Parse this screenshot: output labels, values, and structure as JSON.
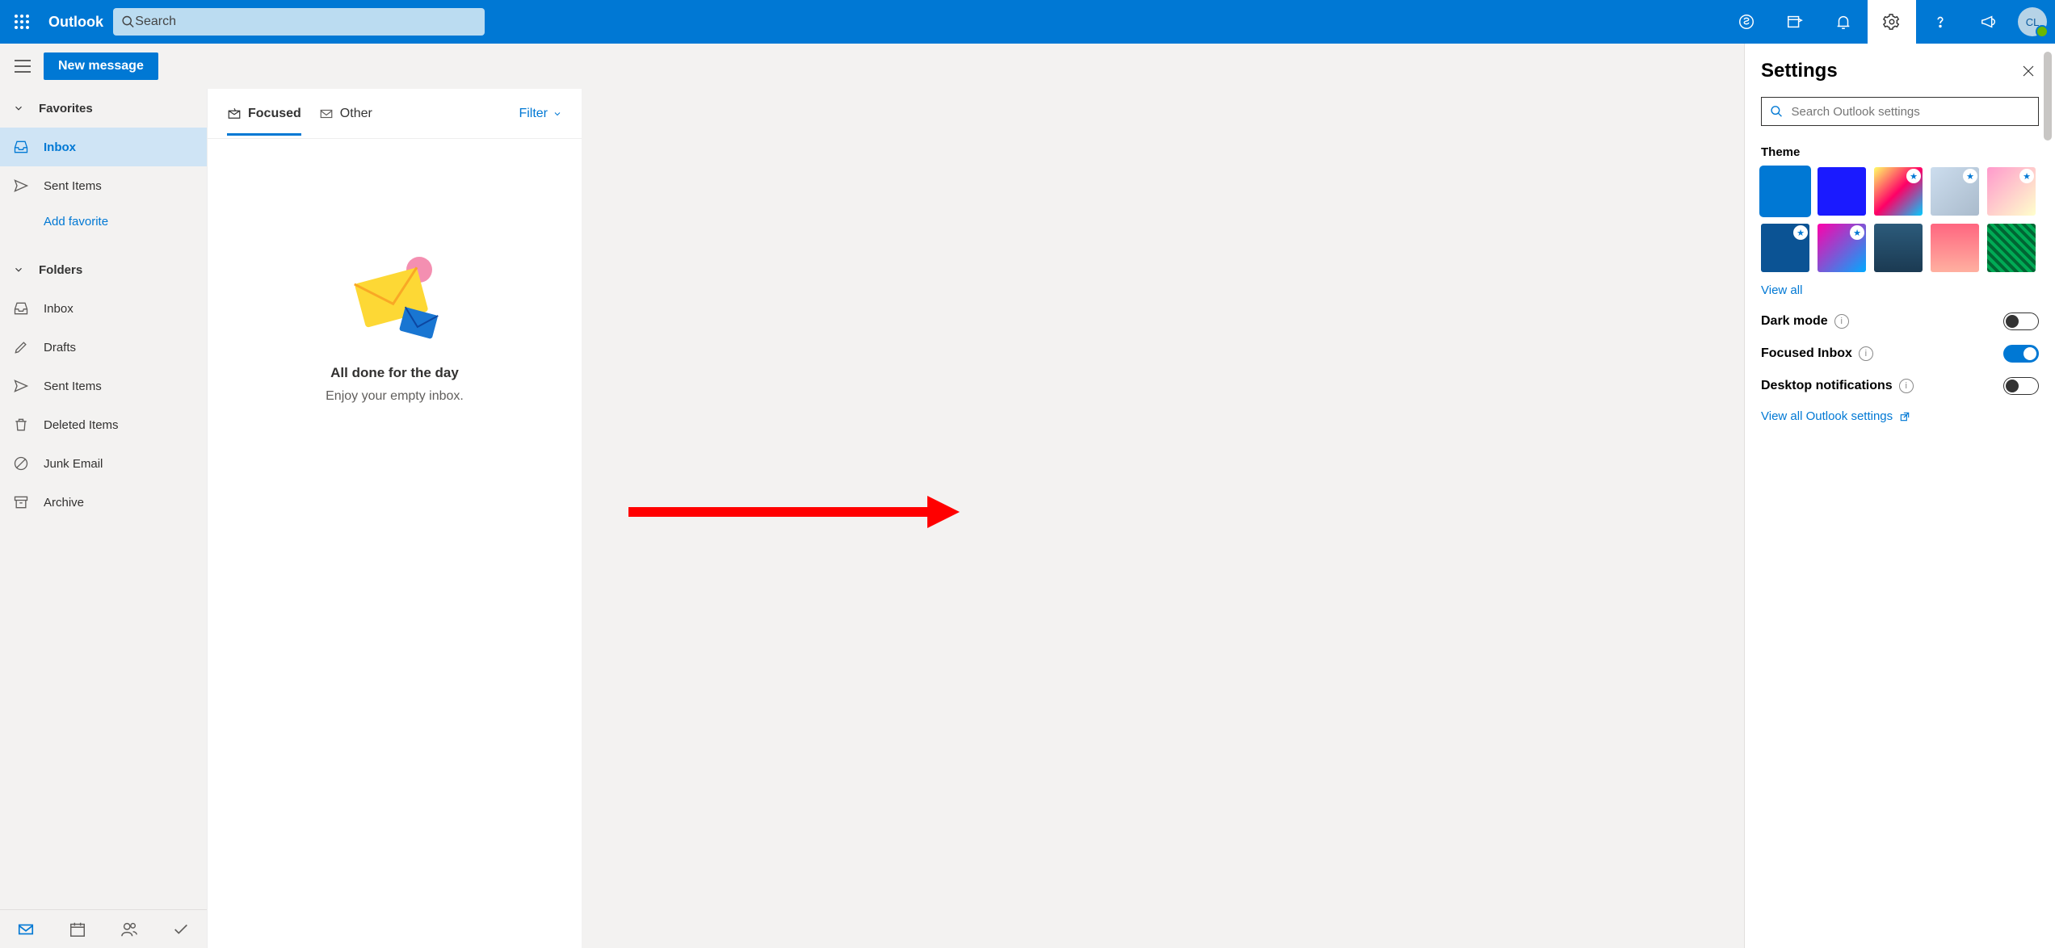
{
  "header": {
    "title": "Outlook",
    "search_placeholder": "Search",
    "avatar_initials": "CL"
  },
  "cmdbar": {
    "new_message": "New message"
  },
  "sidebar": {
    "favorites_header": "Favorites",
    "folders_header": "Folders",
    "add_favorite": "Add favorite",
    "favorites": [
      {
        "icon": "inbox",
        "label": "Inbox",
        "selected": true
      },
      {
        "icon": "send",
        "label": "Sent Items",
        "selected": false
      }
    ],
    "folders": [
      {
        "icon": "inbox",
        "label": "Inbox"
      },
      {
        "icon": "draft",
        "label": "Drafts"
      },
      {
        "icon": "send",
        "label": "Sent Items"
      },
      {
        "icon": "trash",
        "label": "Deleted Items"
      },
      {
        "icon": "block",
        "label": "Junk Email"
      },
      {
        "icon": "archive",
        "label": "Archive"
      }
    ]
  },
  "msglist": {
    "tab_focused": "Focused",
    "tab_other": "Other",
    "filter": "Filter",
    "empty_title": "All done for the day",
    "empty_sub": "Enjoy your empty inbox."
  },
  "settings": {
    "title": "Settings",
    "search_placeholder": "Search Outlook settings",
    "theme_label": "Theme",
    "view_all_themes": "View all",
    "dark_mode": "Dark mode",
    "focused_inbox": "Focused Inbox",
    "desktop_notifications": "Desktop notifications",
    "view_all_settings": "View all Outlook settings",
    "toggles": {
      "dark_mode": false,
      "focused_inbox": true,
      "desktop_notifications": false
    },
    "themes": [
      {
        "bg": "#0078d4",
        "selected": true,
        "premium": false
      },
      {
        "bg": "#1a1aff",
        "selected": false,
        "premium": false
      },
      {
        "bg": "linear-gradient(135deg,#ff6,#f06,#0cf)",
        "selected": false,
        "premium": true
      },
      {
        "bg": "linear-gradient(135deg,#cde,#abc)",
        "selected": false,
        "premium": true
      },
      {
        "bg": "linear-gradient(135deg,#f9c,#ffc)",
        "selected": false,
        "premium": true
      },
      {
        "bg": "#0b5394",
        "selected": false,
        "premium": true
      },
      {
        "bg": "linear-gradient(135deg,#f0a,#0af)",
        "selected": false,
        "premium": true
      },
      {
        "bg": "linear-gradient(#2c5b7b,#1b3a52)",
        "selected": false,
        "premium": false
      },
      {
        "bg": "linear-gradient(#ff6680,#ffb0a0)",
        "selected": false,
        "premium": false
      },
      {
        "bg": "repeating-linear-gradient(45deg,#063,#063 4px,#0a5 4px,#0a5 8px)",
        "selected": false,
        "premium": false
      }
    ]
  }
}
